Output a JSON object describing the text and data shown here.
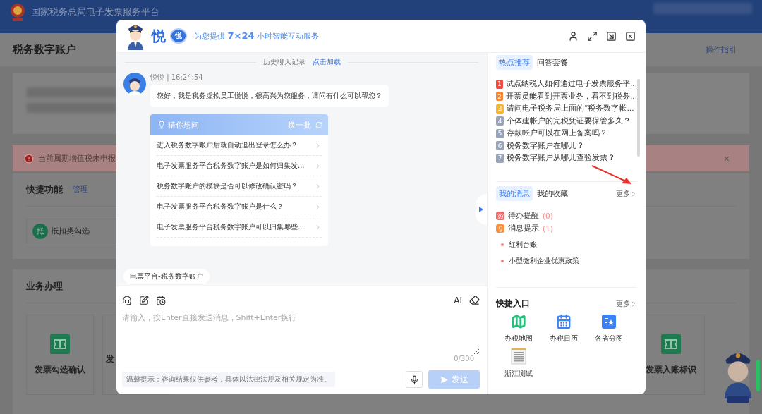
{
  "platform": {
    "title": "国家税务总局电子发票服务平台"
  },
  "account": {
    "heading": "税务数字账户",
    "guide_link": "操作指引"
  },
  "alert": {
    "text": "当前属期增值税未申报",
    "close": "×"
  },
  "quick_functions": {
    "title": "快捷功能",
    "manage": "管理",
    "items": [
      {
        "badge": "抵",
        "label": "抵扣类勾选"
      }
    ]
  },
  "business": {
    "title": "业务办理",
    "tiles": [
      {
        "label": "发票勾选确认",
        "kind": "icon"
      },
      {
        "label": "发",
        "kind": "text"
      },
      {
        "label": "发票入账标识",
        "kind": "icon"
      }
    ]
  },
  "assistant": {
    "name": "悦",
    "badge": "悦",
    "slogan": "为您提供 **7×24** 小时智能互动服务",
    "history": {
      "text": "历史聊天记录",
      "link": "点击加载"
    },
    "message": {
      "sender": "悦悦 | 16:24:54",
      "text": "您好，我是税务虚拟员工悦悦，很高兴为您服务，请问有什么可以帮您？"
    },
    "suggestions": {
      "title": "猜你想问",
      "refresh": "换一批",
      "questions": [
        "进入税务数字账户后就自动退出登录怎么办？",
        "电子发票服务平台税务数字账户是如何归集发...",
        "税务数字账户的模块是否可以修改确认密码？",
        "电子发票服务平台税务数字账户是什么？",
        "电子发票服务平台税务数字账户可以归集哪些..."
      ]
    },
    "context_tag": "电票平台-税务数字账户",
    "input": {
      "ai": "AI",
      "placeholder": "请输入，按Enter直接发送消息，Shift+Enter换行",
      "counter": "0/300",
      "hint": "温馨提示：咨询结果仅供参考，具体以法律法规及相关规定为准。",
      "send": {
        "label": "发送",
        "disabled": true
      }
    },
    "hot_tabs": [
      {
        "label": "热点推荐",
        "selected": true
      },
      {
        "label": "问答套餐",
        "selected": false
      }
    ],
    "hot_items": [
      {
        "rank": "1",
        "color": "#f04b3d",
        "text": "试点纳税人如何通过电子发票服务平..."
      },
      {
        "rank": "2",
        "color": "#f5873a",
        "text": "开票员能看到开票业务，看不到税务..."
      },
      {
        "rank": "3",
        "color": "#f8b432",
        "text": "请问电子税务局上面的“税务数字帐..."
      },
      {
        "rank": "4",
        "color": "#9aa4b8",
        "text": "个体建帐户的完税凭证要保管多久？"
      },
      {
        "rank": "5",
        "color": "#9aa4b8",
        "text": "存款帐户可以在网上备案吗？"
      },
      {
        "rank": "6",
        "color": "#9aa4b8",
        "text": "税务数字账户在哪儿？"
      },
      {
        "rank": "7",
        "color": "#9aa4b8",
        "text": "税务数字账户从哪儿查验发票？"
      }
    ],
    "message_tabs": [
      {
        "label": "我的消息",
        "selected": true
      },
      {
        "label": "我的收藏",
        "selected": false
      }
    ],
    "messages_more": "更多",
    "notices": [
      {
        "label": "待办提醒",
        "count": "(0)",
        "color": "#f26b6b",
        "kind": "clock"
      },
      {
        "label": "消息提示",
        "count": "(1)",
        "color": "#f7913d",
        "kind": "bulb"
      }
    ],
    "links": [
      "红利台账",
      "小型微利企业优惠政策"
    ],
    "quick_entry": {
      "title": "快捷入口",
      "more": "更多",
      "items": [
        {
          "label": "办税地图",
          "kind": "map"
        },
        {
          "label": "办税日历",
          "kind": "calendar"
        },
        {
          "label": "各省分图",
          "kind": "board"
        },
        {
          "label": "浙江测试",
          "kind": "document"
        }
      ]
    }
  }
}
